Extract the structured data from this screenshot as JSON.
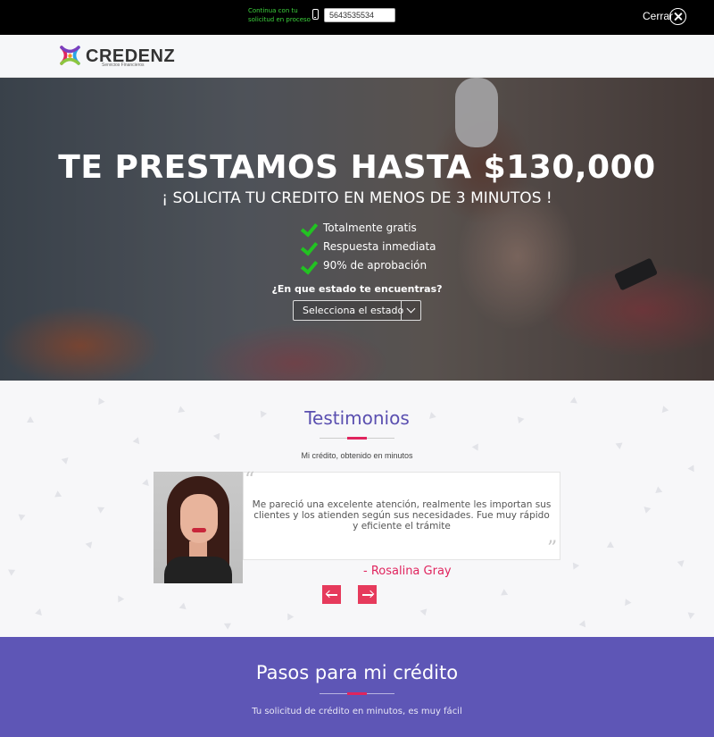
{
  "topbar": {
    "resume_text": "Continua con tu solicitud en proceso",
    "phone_value": "5643535534",
    "close_label": "Cerrar"
  },
  "brand": {
    "name": "CREDENZ",
    "tagline": "Servicios Financieros"
  },
  "hero": {
    "title": "TE PRESTAMOS HASTA $130,000",
    "subtitle": "¡ SOLICITA TU CREDITO EN MENOS DE 3 MINUTOS !",
    "benefits": [
      "Totalmente gratis",
      "Respuesta inmediata",
      "90% de aprobación"
    ],
    "question": "¿En que estado te encuentras?",
    "state_select": "Selecciona el estado"
  },
  "testimonials": {
    "title": "Testimonios",
    "subtitle": "Mi crédito, obtenido en minutos",
    "quote": "Me pareció una excelente atención, realmente les importan sus clientes y los atienden según sus necesidades. Fue muy rápido y eficiente el trámite",
    "author": "- Rosalina Gray"
  },
  "steps": {
    "title": "Pasos para mi crédito",
    "subtitle": "Tu solicitud de crédito en minutos, es muy fácil"
  },
  "colors": {
    "accent": "#e0245e",
    "brand_purple": "#5e56b6",
    "check_green": "#22c322"
  }
}
